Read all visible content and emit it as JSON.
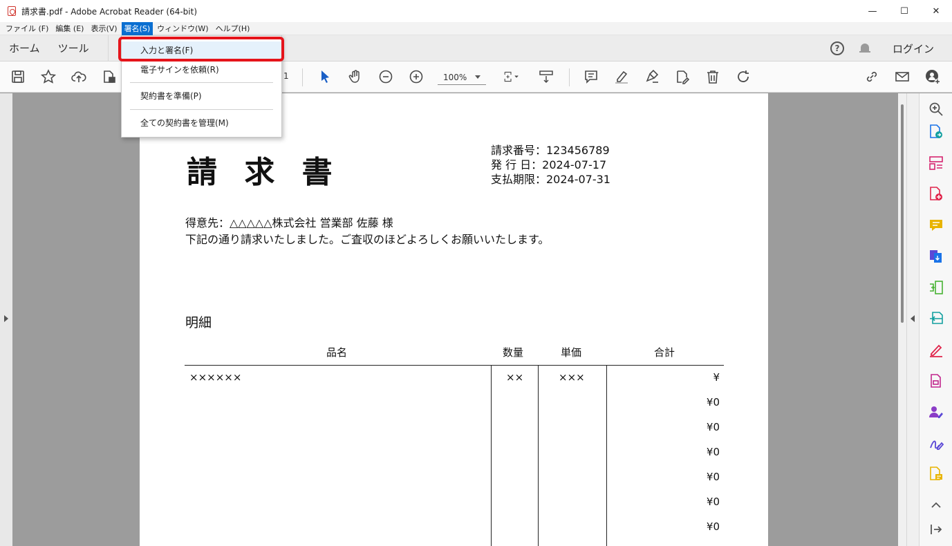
{
  "window": {
    "title": "請求書.pdf - Adobe Acrobat Reader (64-bit)",
    "controls": {
      "minimize": "—",
      "maximize": "☐",
      "close": "✕"
    }
  },
  "menubar": {
    "items": [
      {
        "label": "ファイル (F)"
      },
      {
        "label": "編集 (E)"
      },
      {
        "label": "表示(V)"
      },
      {
        "label": "署名(S)",
        "active": true
      },
      {
        "label": "ウィンドウ(W)"
      },
      {
        "label": "ヘルプ(H)"
      }
    ]
  },
  "navbar": {
    "tabs": [
      {
        "label": "ホーム"
      },
      {
        "label": "ツール"
      }
    ],
    "help_glyph": "?",
    "login_label": "ログイン"
  },
  "toolbar": {
    "page_number": "1",
    "zoom": "100%"
  },
  "signature_menu": {
    "items": [
      {
        "label": "入力と署名(F)",
        "highlighted": true
      },
      {
        "label": "電子サインを依頼(R)"
      },
      {
        "label": "契約書を準備(P)"
      },
      {
        "label": "全ての契約書を管理(M)"
      }
    ],
    "highlight_color": "#e5141b"
  },
  "document": {
    "title": "請 求 書",
    "meta": {
      "invoice_no": "請求番号：123456789",
      "issue_date": "発 行 日：2024-07-17",
      "due_date": "支払期限：2024-07-31"
    },
    "recipient": "得意先：△△△△△株式会社 営業部 佐藤 様",
    "message": "下記の通り請求いたしました。ご査収のほどよろしくお願いいたします。",
    "detail_label": "明細",
    "table": {
      "headers": {
        "name": "品名",
        "qty": "数量",
        "price": "単価",
        "total": "合計"
      },
      "first_row": {
        "name": "××××××",
        "qty": "××",
        "price": "×××",
        "total": "¥"
      },
      "amounts": [
        "¥0",
        "¥0",
        "¥0",
        "¥0",
        "¥0",
        "¥0"
      ]
    }
  },
  "colors": {
    "menu_active": "#0b6fd1",
    "highlight": "#e5141b",
    "right_pane_icons": [
      "#555555",
      "#1a73e8",
      "#d6246e",
      "#e0244b",
      "#e8b400",
      "#5b48d6",
      "#47b332",
      "#14a0a0",
      "#e0244b",
      "#c2268d",
      "#8b3dc7",
      "#5b48d6",
      "#e8b400",
      "#555555",
      "#555555"
    ]
  }
}
